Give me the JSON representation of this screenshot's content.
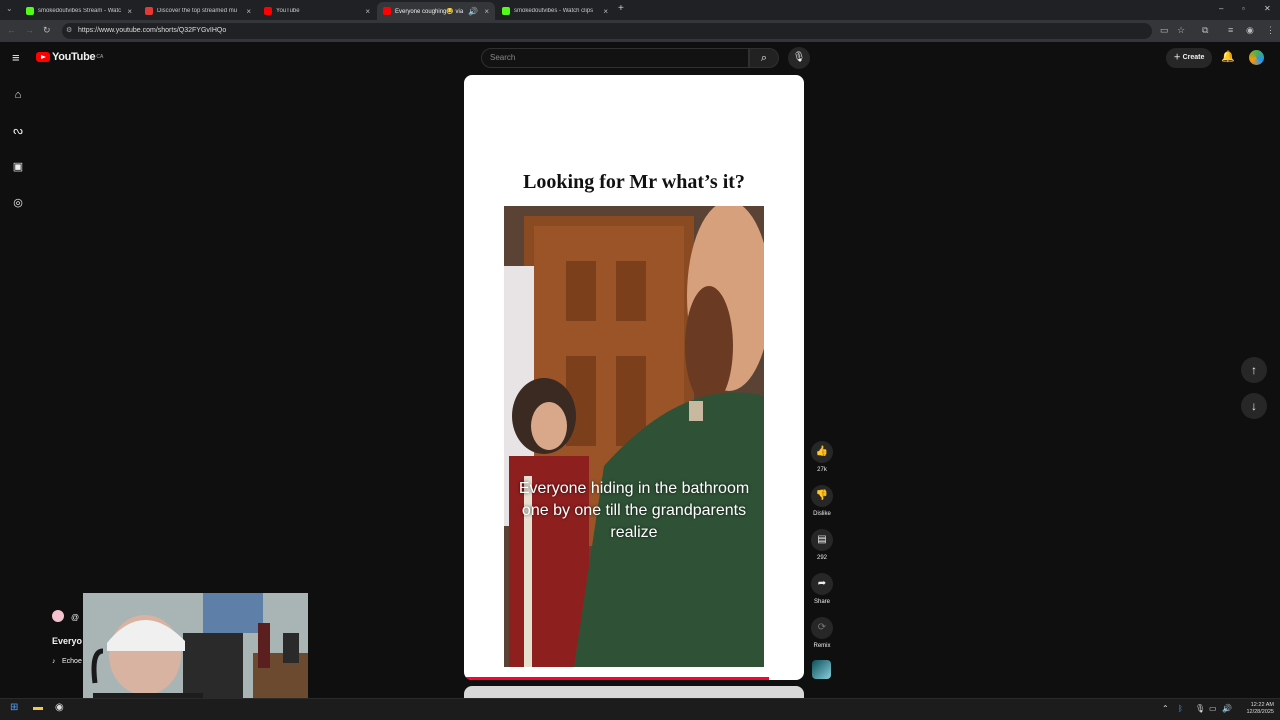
{
  "browser": {
    "tabs": [
      {
        "title": "smokedoutvibes Stream - Watc",
        "favicon_color": "#53fc18"
      },
      {
        "title": "Discover the top streamed mu",
        "favicon_color": "#e53935"
      },
      {
        "title": "YouTube",
        "favicon_color": "#ff0000"
      },
      {
        "title": "Everyone coughing😂 via",
        "favicon_color": "#ff0000"
      },
      {
        "title": "smokedoutvibes - Watch clips",
        "favicon_color": "#53fc18"
      }
    ],
    "url": "https://www.youtube.com/shorts/Q32FYGvIHQo"
  },
  "header": {
    "logo_text": "YouTube",
    "region": "CA",
    "search_placeholder": "Search",
    "create_label": "Create"
  },
  "short": {
    "heading": "Looking for Mr what’s it?",
    "caption": "Everyone hiding in the bathroom one by one till the grandparents realize",
    "likes": "27k",
    "dislike_label": "Dislike",
    "comments": "292",
    "share_label": "Share",
    "remix_label": "Remix"
  },
  "channel": {
    "handle": "@",
    "title": "Everyo",
    "music": "Echoe"
  },
  "taskbar": {
    "time": "12:22 AM",
    "date": "12/28/2025"
  },
  "colors": {
    "accent": "#ff0000",
    "progress": "#ff0033",
    "background": "#0f0f0f"
  }
}
